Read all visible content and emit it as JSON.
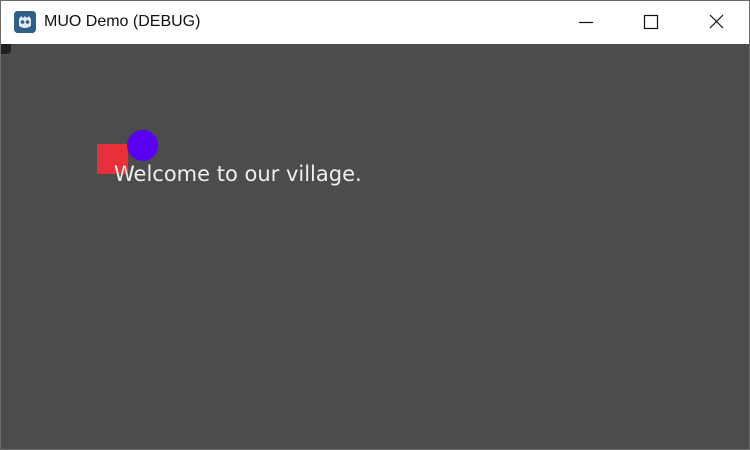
{
  "window": {
    "title": "MUO Demo (DEBUG)",
    "icon": "godot-engine-icon",
    "controls": {
      "minimize_icon": "minimize-icon",
      "maximize_icon": "maximize-icon",
      "close_icon": "close-icon"
    }
  },
  "scene": {
    "background_color": "#4c4c4c",
    "label": "Welcome to our village.",
    "shapes": [
      {
        "name": "red-square",
        "color": "#e8303a"
      },
      {
        "name": "blue-circle",
        "color": "#5a00f2"
      }
    ]
  }
}
